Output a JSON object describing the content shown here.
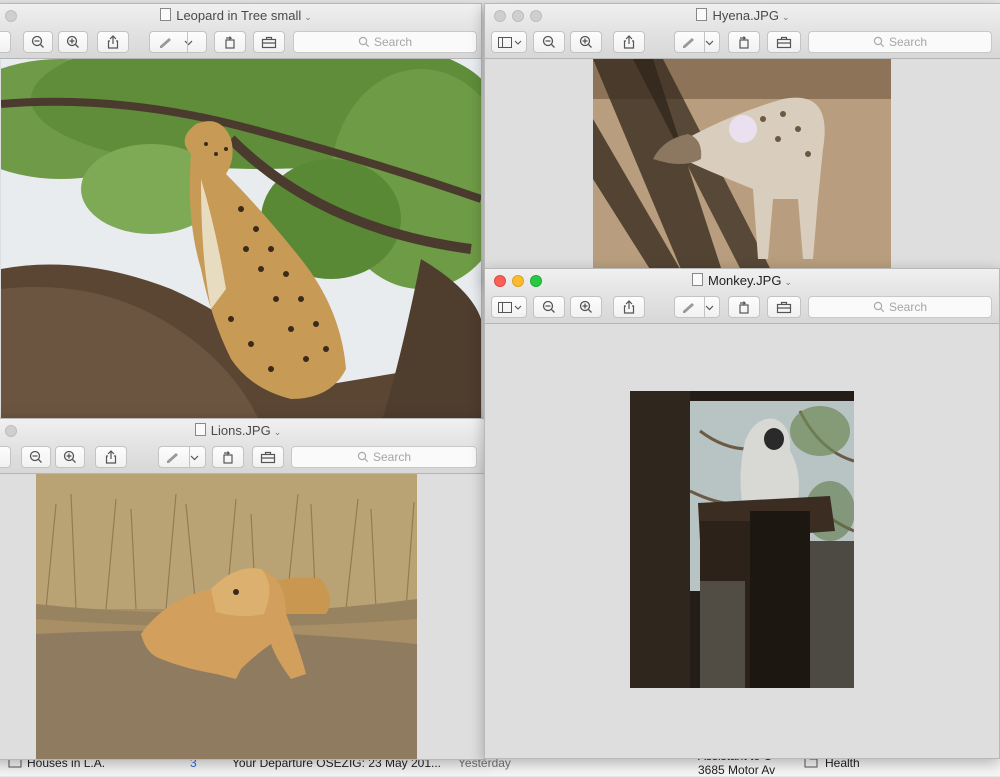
{
  "windows": {
    "leopard": {
      "title": "Leopard in Tree small",
      "search_placeholder": "Search"
    },
    "hyena": {
      "title": "Hyena.JPG",
      "search_placeholder": "Search"
    },
    "lions": {
      "title": "Lions.JPG",
      "search_placeholder": "Search"
    },
    "monkey": {
      "title": "Monkey.JPG",
      "search_placeholder": "Search"
    }
  },
  "background": {
    "mail_folder": "Houses in L.A.",
    "mail_folder_count": "3",
    "mail_subject": "Your Departure OSEZIG: 23 May 201...",
    "mail_date": "Yesterday",
    "contact_line1": "Assistant to C",
    "contact_line2": "3685 Motor Av",
    "folder_health": "Health"
  },
  "colors": {
    "close": "#fc5f57",
    "minimize": "#fdbc2e",
    "zoom": "#28c840",
    "count_badge": "#2a6fd6"
  }
}
